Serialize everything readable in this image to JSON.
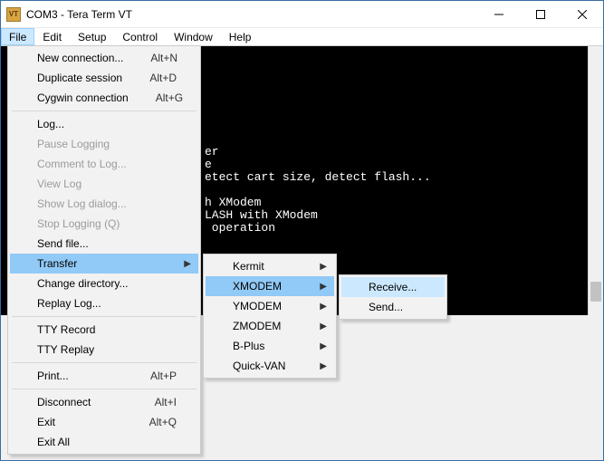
{
  "titlebar": {
    "icon_text": "VT",
    "title": "COM3 - Tera Term VT"
  },
  "menubar": {
    "items": [
      "File",
      "Edit",
      "Setup",
      "Control",
      "Window",
      "Help"
    ]
  },
  "terminal": {
    "lines": "er\ne\netect cart size, detect flash...\n\nh XModem\nLASH with XModem\n operation"
  },
  "file_menu": {
    "new_connection": "New connection...",
    "new_connection_accel": "Alt+N",
    "duplicate_session": "Duplicate session",
    "duplicate_session_accel": "Alt+D",
    "cygwin_connection": "Cygwin connection",
    "cygwin_connection_accel": "Alt+G",
    "log": "Log...",
    "pause_logging": "Pause Logging",
    "comment_to_log": "Comment to Log...",
    "view_log": "View Log",
    "show_log_dialog": "Show Log dialog...",
    "stop_logging": "Stop Logging (Q)",
    "send_file": "Send file...",
    "transfer": "Transfer",
    "change_directory": "Change directory...",
    "replay_log": "Replay Log...",
    "tty_record": "TTY Record",
    "tty_replay": "TTY Replay",
    "print": "Print...",
    "print_accel": "Alt+P",
    "disconnect": "Disconnect",
    "disconnect_accel": "Alt+I",
    "exit": "Exit",
    "exit_accel": "Alt+Q",
    "exit_all": "Exit All"
  },
  "transfer_menu": {
    "kermit": "Kermit",
    "xmodem": "XMODEM",
    "ymodem": "YMODEM",
    "zmodem": "ZMODEM",
    "bplus": "B-Plus",
    "quickvan": "Quick-VAN"
  },
  "xmodem_menu": {
    "receive": "Receive...",
    "send": "Send..."
  }
}
